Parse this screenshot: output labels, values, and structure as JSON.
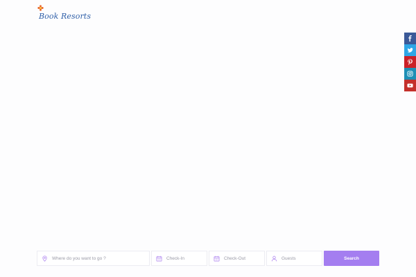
{
  "brand": {
    "logo_text": "Book Resorts",
    "logo_icon": "flower-icon",
    "wordmark_color": "#2f5fa8"
  },
  "social": [
    {
      "name": "facebook",
      "icon": "facebook-icon",
      "color": "#3b5998"
    },
    {
      "name": "twitter",
      "icon": "twitter-icon",
      "color": "#2fa6e6"
    },
    {
      "name": "pinterest",
      "icon": "pinterest-icon",
      "color": "#cb2027"
    },
    {
      "name": "instagram",
      "icon": "instagram-icon",
      "color": "#1e8fb5"
    },
    {
      "name": "youtube",
      "icon": "youtube-icon",
      "color": "#c4302b"
    }
  ],
  "search": {
    "destination_placeholder": "Where do you want to go ?",
    "checkin_placeholder": "Check-In",
    "checkout_placeholder": "Check-Out",
    "guests_placeholder": "Guests",
    "button_label": "Search",
    "icon_color": "#b48df0",
    "button_color": "#a47ef0"
  }
}
